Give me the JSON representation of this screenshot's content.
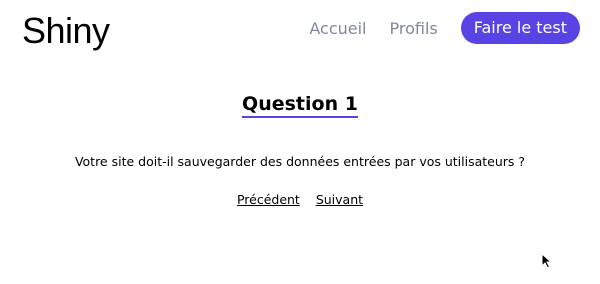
{
  "header": {
    "logo_text": "Shiny",
    "nav": {
      "home_label": "Accueil",
      "profiles_label": "Profils",
      "cta_label": "Faire le test"
    }
  },
  "survey": {
    "title": "Question 1",
    "question": "Votre site doit-il sauvegarder des données entrées par vos utilisateurs ?",
    "previous_label": "Précédent",
    "next_label": "Suivant"
  },
  "colors": {
    "accent": "#5843e4",
    "nav_link": "#8186a0",
    "text": "#000000",
    "background": "#ffffff"
  },
  "icons": {
    "cursor": "mouse-pointer-icon"
  }
}
